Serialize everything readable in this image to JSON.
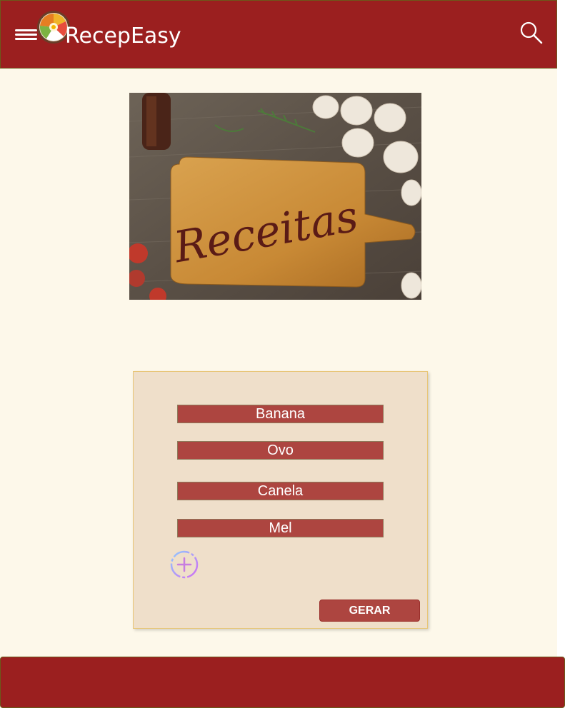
{
  "header": {
    "title": "RecepEasy",
    "menu_icon": "hamburger-menu-icon",
    "logo_icon": "food-bowl-logo",
    "search_icon": "search-icon"
  },
  "hero": {
    "image_text": "Receitas",
    "description": "cutting board on wooden table with mushrooms, tomatoes and herbs"
  },
  "ingredients_card": {
    "items": [
      "Banana",
      "Ovo",
      "Canela",
      "Mel"
    ],
    "add_icon": "add-circle-icon",
    "generate_label": "GERAR"
  },
  "colors": {
    "primary": "#9b1f1f",
    "field": "#ad4540",
    "card": "#efdfca",
    "background": "#fdf8ea"
  }
}
